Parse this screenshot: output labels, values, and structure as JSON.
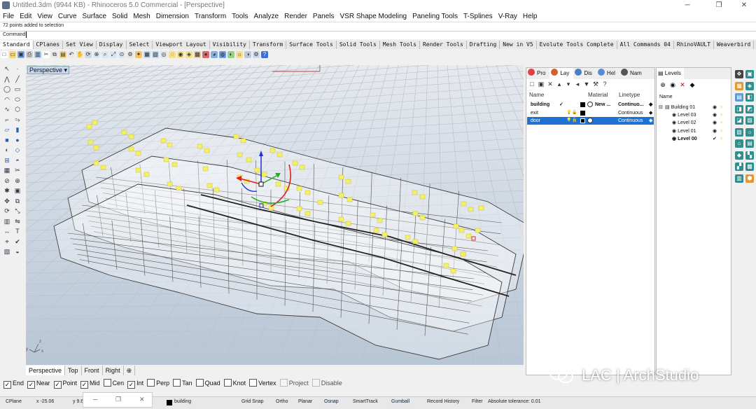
{
  "window": {
    "title": "Untitled.3dm (9944 KB) - Rhinoceros 5.0 Commercial - [Perspective]",
    "minimize_glyph": "─",
    "restore_glyph": "❐",
    "close_glyph": "✕"
  },
  "menu": [
    "File",
    "Edit",
    "View",
    "Curve",
    "Surface",
    "Solid",
    "Mesh",
    "Dimension",
    "Transform",
    "Tools",
    "Analyze",
    "Render",
    "Panels",
    "VSR Shape Modeling",
    "Paneling Tools",
    "T-Splines",
    "V-Ray",
    "Help"
  ],
  "command": {
    "history": "72 points added to selection",
    "prompt": "Command:"
  },
  "toolbar_tabs": [
    "Standard",
    "CPlanes",
    "Set View",
    "Display",
    "Select",
    "Viewport Layout",
    "Visibility",
    "Transform",
    "Surface Tools",
    "Solid Tools",
    "Mesh Tools",
    "Render Tools",
    "Drafting",
    "New in V5",
    "Evolute Tools Complete",
    "All Commands 04",
    "RhinoVAULT",
    "Weaverbird"
  ],
  "viewport": {
    "label": "Perspective",
    "dropdown_glyph": "▾",
    "tabs": [
      "Perspective",
      "Top",
      "Front",
      "Right"
    ],
    "add_tab_glyph": "⊕",
    "axis_x": "x",
    "axis_y": "y",
    "axis_z": "z"
  },
  "osnaps": [
    {
      "label": "End",
      "checked": true
    },
    {
      "label": "Near",
      "checked": true
    },
    {
      "label": "Point",
      "checked": true
    },
    {
      "label": "Mid",
      "checked": true
    },
    {
      "label": "Cen",
      "checked": false
    },
    {
      "label": "Int",
      "checked": true
    },
    {
      "label": "Perp",
      "checked": false
    },
    {
      "label": "Tan",
      "checked": false
    },
    {
      "label": "Quad",
      "checked": false
    },
    {
      "label": "Knot",
      "checked": false
    },
    {
      "label": "Vertex",
      "checked": false
    },
    {
      "label": "Project",
      "checked": false,
      "disabled": true
    },
    {
      "label": "Disable",
      "checked": false,
      "disabled": true
    }
  ],
  "status": {
    "cplane": "CPlane",
    "x": "x -25.06",
    "y": "y 9.6",
    "layer": "building",
    "grid_snap": "Grid Snap",
    "ortho": "Ortho",
    "planar": "Planar",
    "osnap": "Osnap",
    "smarttrack": "SmartTrack",
    "gumball": "Gumball",
    "record_history": "Record History",
    "filter": "Filter",
    "tolerance": "Absolute tolerance: 0.01"
  },
  "layers_panel": {
    "tabs": [
      "Pro",
      "Lay",
      "Dis",
      "Hel",
      "Nam"
    ],
    "columns": {
      "name": "Name",
      "material": "Material",
      "linetype": "Linetype"
    },
    "rows": [
      {
        "name": "building",
        "current": "✓",
        "material": "New ...",
        "linetype": "Continuo...",
        "selected": false,
        "bold": true
      },
      {
        "name": "exit",
        "current": "",
        "material": "",
        "linetype": "Continuous",
        "selected": false,
        "bold": false
      },
      {
        "name": "door",
        "current": "",
        "material": "",
        "linetype": "Continuous",
        "selected": true,
        "bold": false
      }
    ]
  },
  "levels_panel": {
    "tab": "Levels",
    "column": "Name",
    "items": [
      {
        "name": "Building 01",
        "bold": false
      },
      {
        "name": "Level 03",
        "bold": false
      },
      {
        "name": "Level 02",
        "bold": false
      },
      {
        "name": "Level 01",
        "bold": false
      },
      {
        "name": "Level 00",
        "bold": true
      }
    ]
  },
  "watermark": "LAC | ArchStudio",
  "colors": {
    "selection": "#1e73d2",
    "point_highlight": "#f4f06a",
    "gumball_x": "#e02020",
    "gumball_y": "#20b020",
    "gumball_z": "#2030d0"
  }
}
